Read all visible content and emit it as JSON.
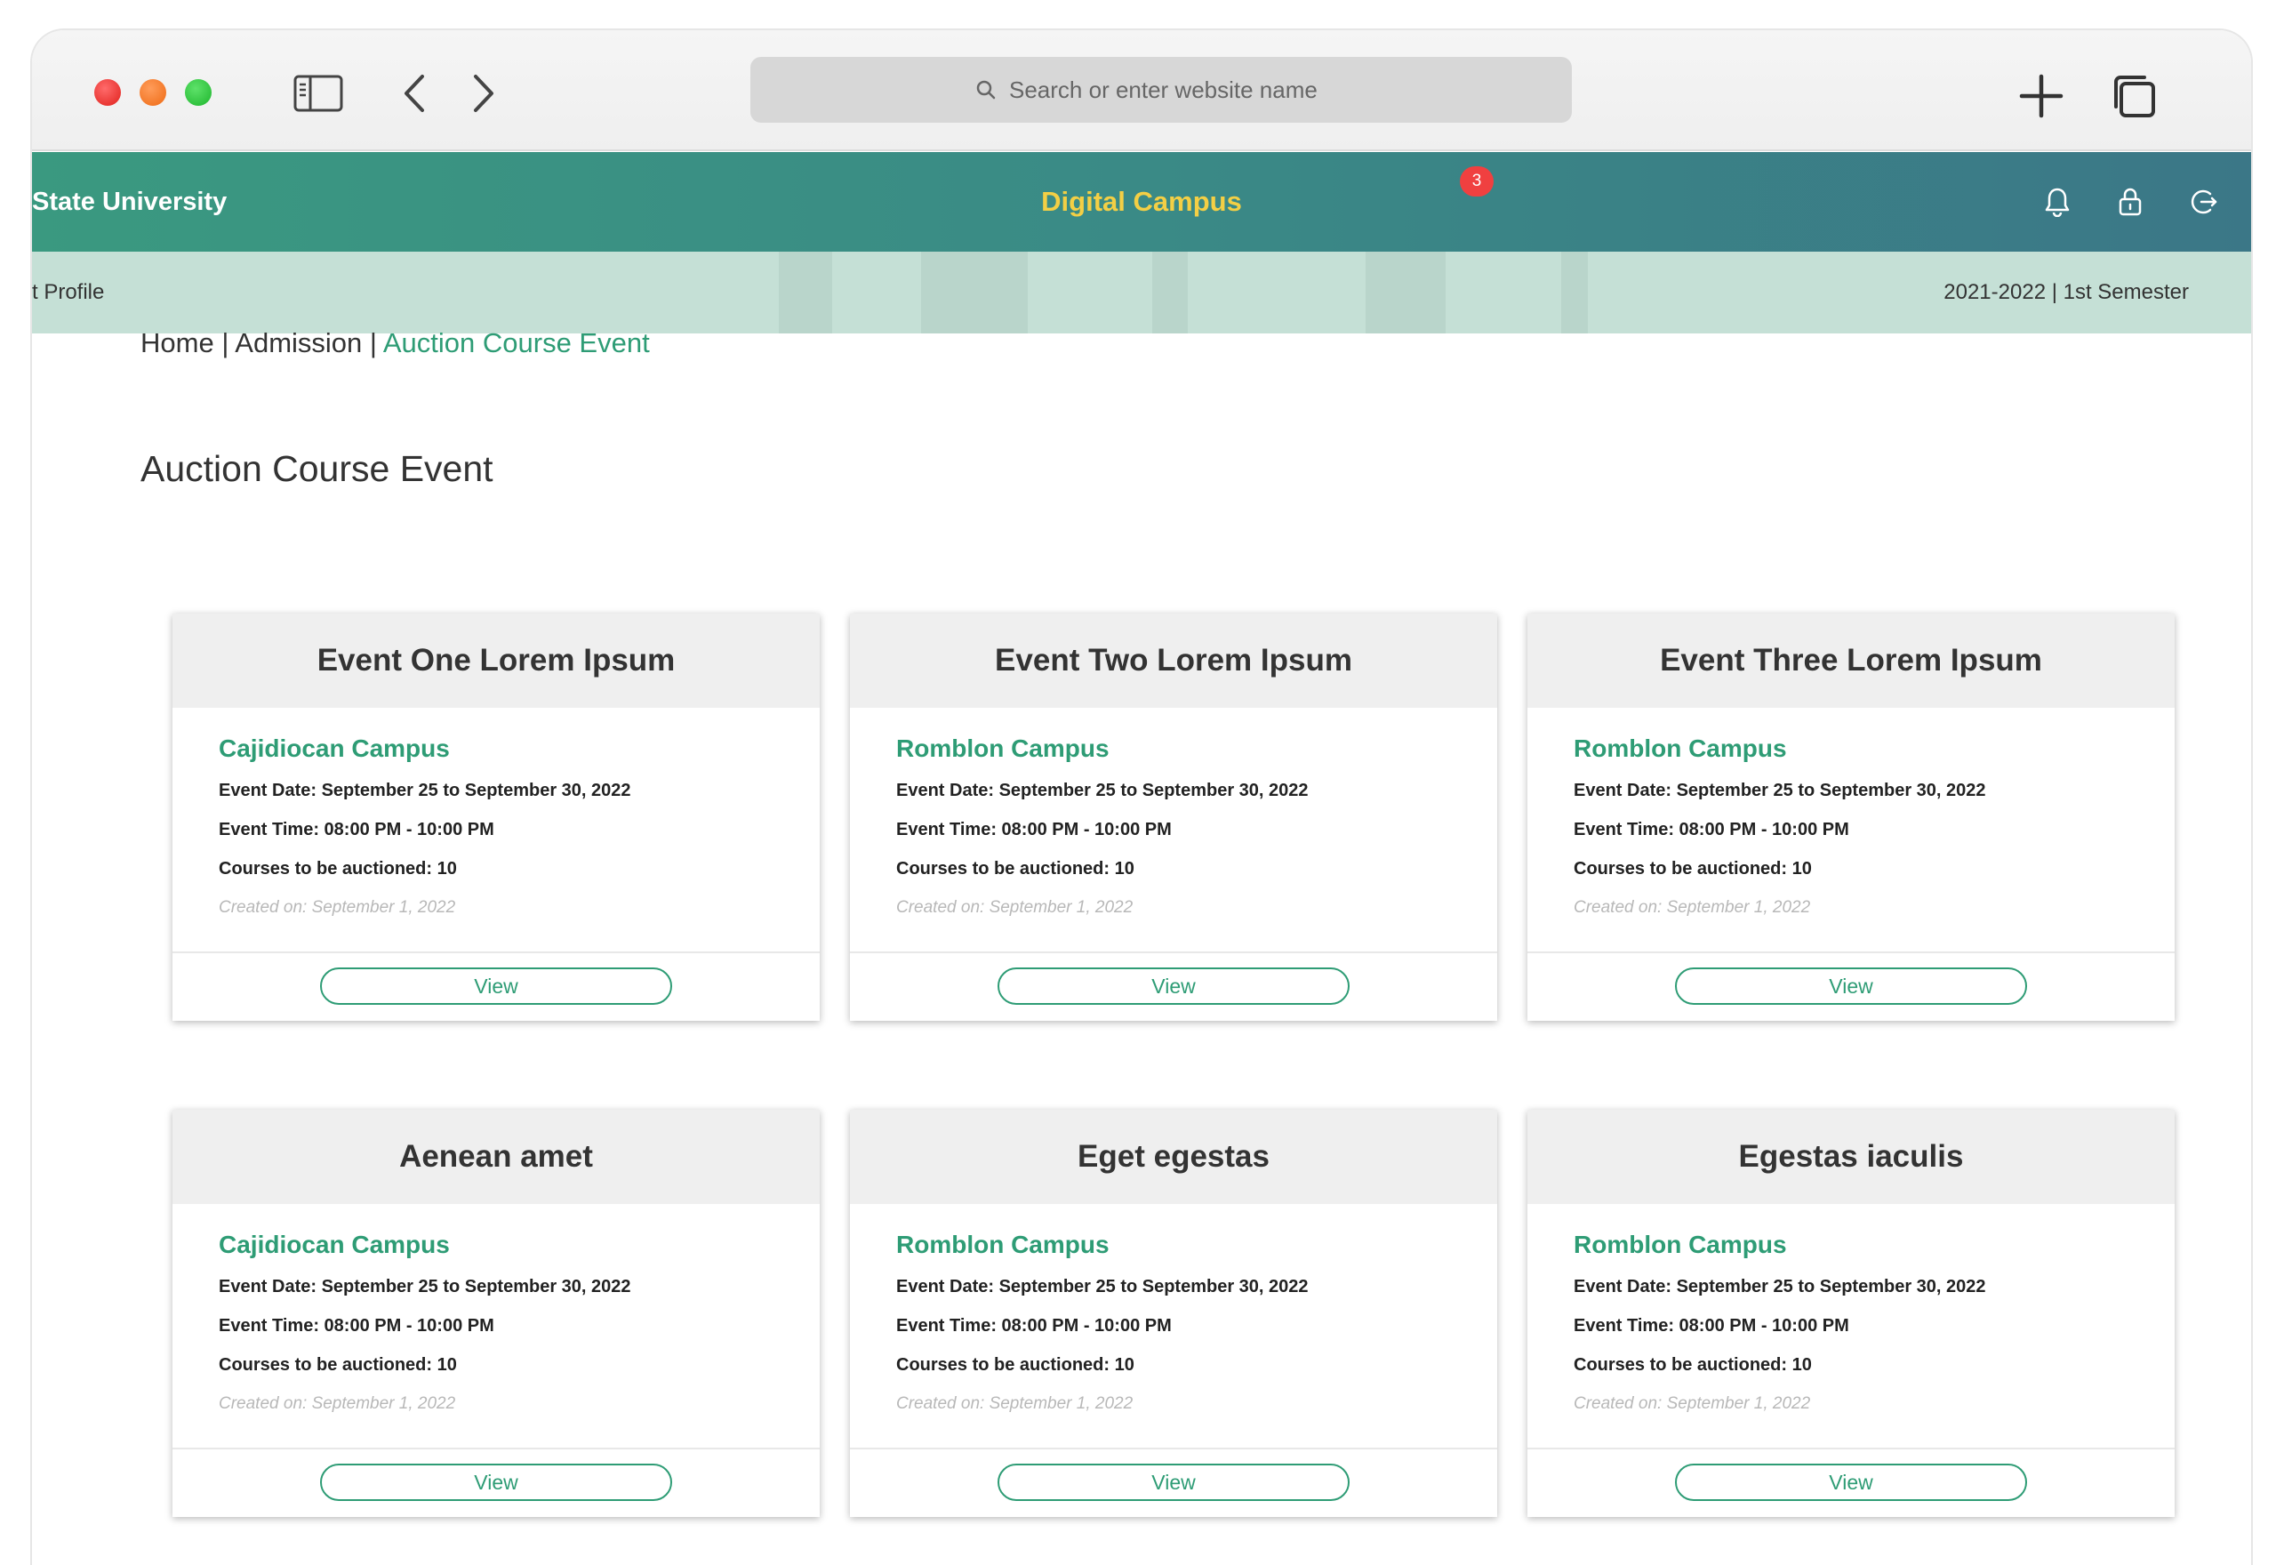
{
  "browser": {
    "search_placeholder": "Search or enter website name",
    "icons": [
      "sidebar-icon",
      "back-icon",
      "forward-icon",
      "new-tab-icon",
      "tabs-overview-icon"
    ]
  },
  "header": {
    "brand": "State University",
    "title": "Digital Campus",
    "notification_count": "3",
    "icons": [
      "bell-icon",
      "lock-icon",
      "logout-icon"
    ],
    "accent_color": "#2e9c75",
    "title_color": "#f3cf45"
  },
  "subbar": {
    "left": "t Profile",
    "right": "2021-2022 | 1st Semester"
  },
  "breadcrumb": {
    "home": "Home",
    "sep1": " | ",
    "admission": "Admission",
    "sep2": " | ",
    "current": "Auction Course Event"
  },
  "page_title": "Auction Course Event",
  "events": [
    {
      "title": "Event One Lorem Ipsum",
      "campus": "Cajidiocan Campus",
      "date": "Event Date: September 25 to September 30, 2022",
      "time": "Event Time: 08:00 PM - 10:00 PM",
      "courses": "Courses to be auctioned: 10",
      "created": "Created on: September 1, 2022",
      "button": "View"
    },
    {
      "title": "Event Two Lorem Ipsum",
      "campus": "Romblon Campus",
      "date": "Event Date: September 25 to September 30, 2022",
      "time": "Event Time: 08:00 PM - 10:00 PM",
      "courses": "Courses to be auctioned: 10",
      "created": "Created on: September 1, 2022",
      "button": "View"
    },
    {
      "title": "Event Three Lorem Ipsum",
      "campus": "Romblon Campus",
      "date": "Event Date: September 25 to September 30, 2022",
      "time": "Event Time: 08:00 PM - 10:00 PM",
      "courses": "Courses to be auctioned: 10",
      "created": "Created on: September 1, 2022",
      "button": "View"
    },
    {
      "title": "Aenean amet",
      "campus": "Cajidiocan Campus",
      "date": "Event Date: September 25 to September 30, 2022",
      "time": "Event Time: 08:00 PM - 10:00 PM",
      "courses": "Courses to be auctioned: 10",
      "created": "Created on: September 1, 2022",
      "button": "View"
    },
    {
      "title": "Eget egestas",
      "campus": "Romblon Campus",
      "date": "Event Date: September 25 to September 30, 2022",
      "time": "Event Time: 08:00 PM - 10:00 PM",
      "courses": "Courses to be auctioned: 10",
      "created": "Created on: September 1, 2022",
      "button": "View"
    },
    {
      "title": "Egestas iaculis",
      "campus": "Romblon Campus",
      "date": "Event Date: September 25 to September 30, 2022",
      "time": "Event Time: 08:00 PM - 10:00 PM",
      "courses": "Courses to be auctioned: 10",
      "created": "Created on: September 1, 2022",
      "button": "View"
    }
  ]
}
